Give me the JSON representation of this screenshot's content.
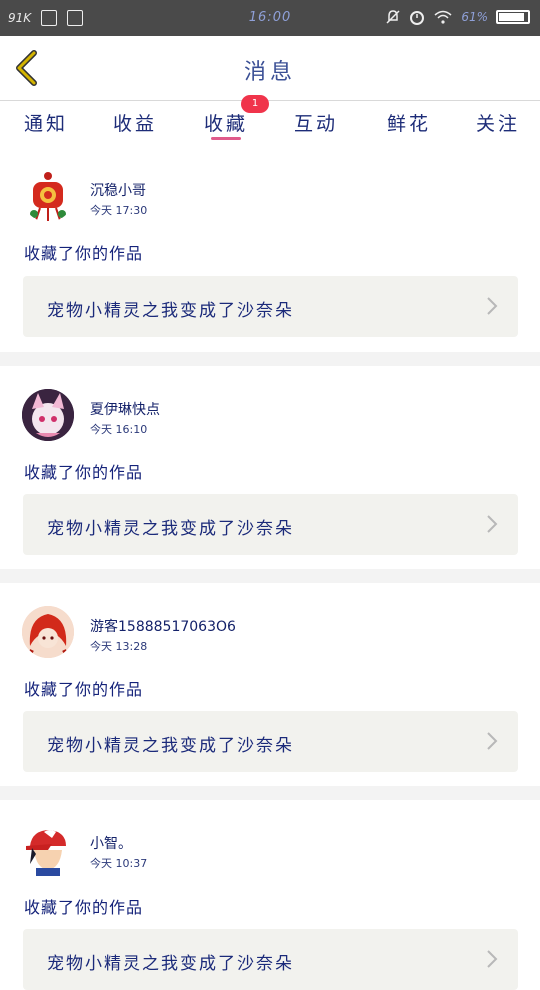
{
  "status_bar": {
    "carrier": "91K",
    "time": "16:00",
    "battery_text": "61%",
    "battery_level": 0.9
  },
  "header": {
    "title": "消息"
  },
  "tabs": [
    {
      "label": "通知"
    },
    {
      "label": "收益"
    },
    {
      "label": "收藏",
      "active": true,
      "badge": "1"
    },
    {
      "label": "互动"
    },
    {
      "label": "鲜花"
    },
    {
      "label": "关注"
    }
  ],
  "messages": [
    {
      "user": "沉稳小哥",
      "time": "今天 17:30",
      "action": "收藏了你的作品",
      "work_title": "宠物小精灵之我变成了沙奈朵"
    },
    {
      "user": "夏伊琳快点",
      "time": "今天 16:10",
      "action": "收藏了你的作品",
      "work_title": "宠物小精灵之我变成了沙奈朵"
    },
    {
      "user": "游客15888517063O6",
      "time": "今天 13:28",
      "action": "收藏了你的作品",
      "work_title": "宠物小精灵之我变成了沙奈朵"
    },
    {
      "user": "小智。",
      "time": "今天 10:37",
      "action": "收藏了你的作品",
      "work_title": "宠物小精灵之我变成了沙奈朵"
    }
  ],
  "colors": {
    "accent": "#e05a8a",
    "badge": "#f0344b",
    "back_arrow": "#c9a800",
    "status_bar": "#4a4a4a"
  }
}
